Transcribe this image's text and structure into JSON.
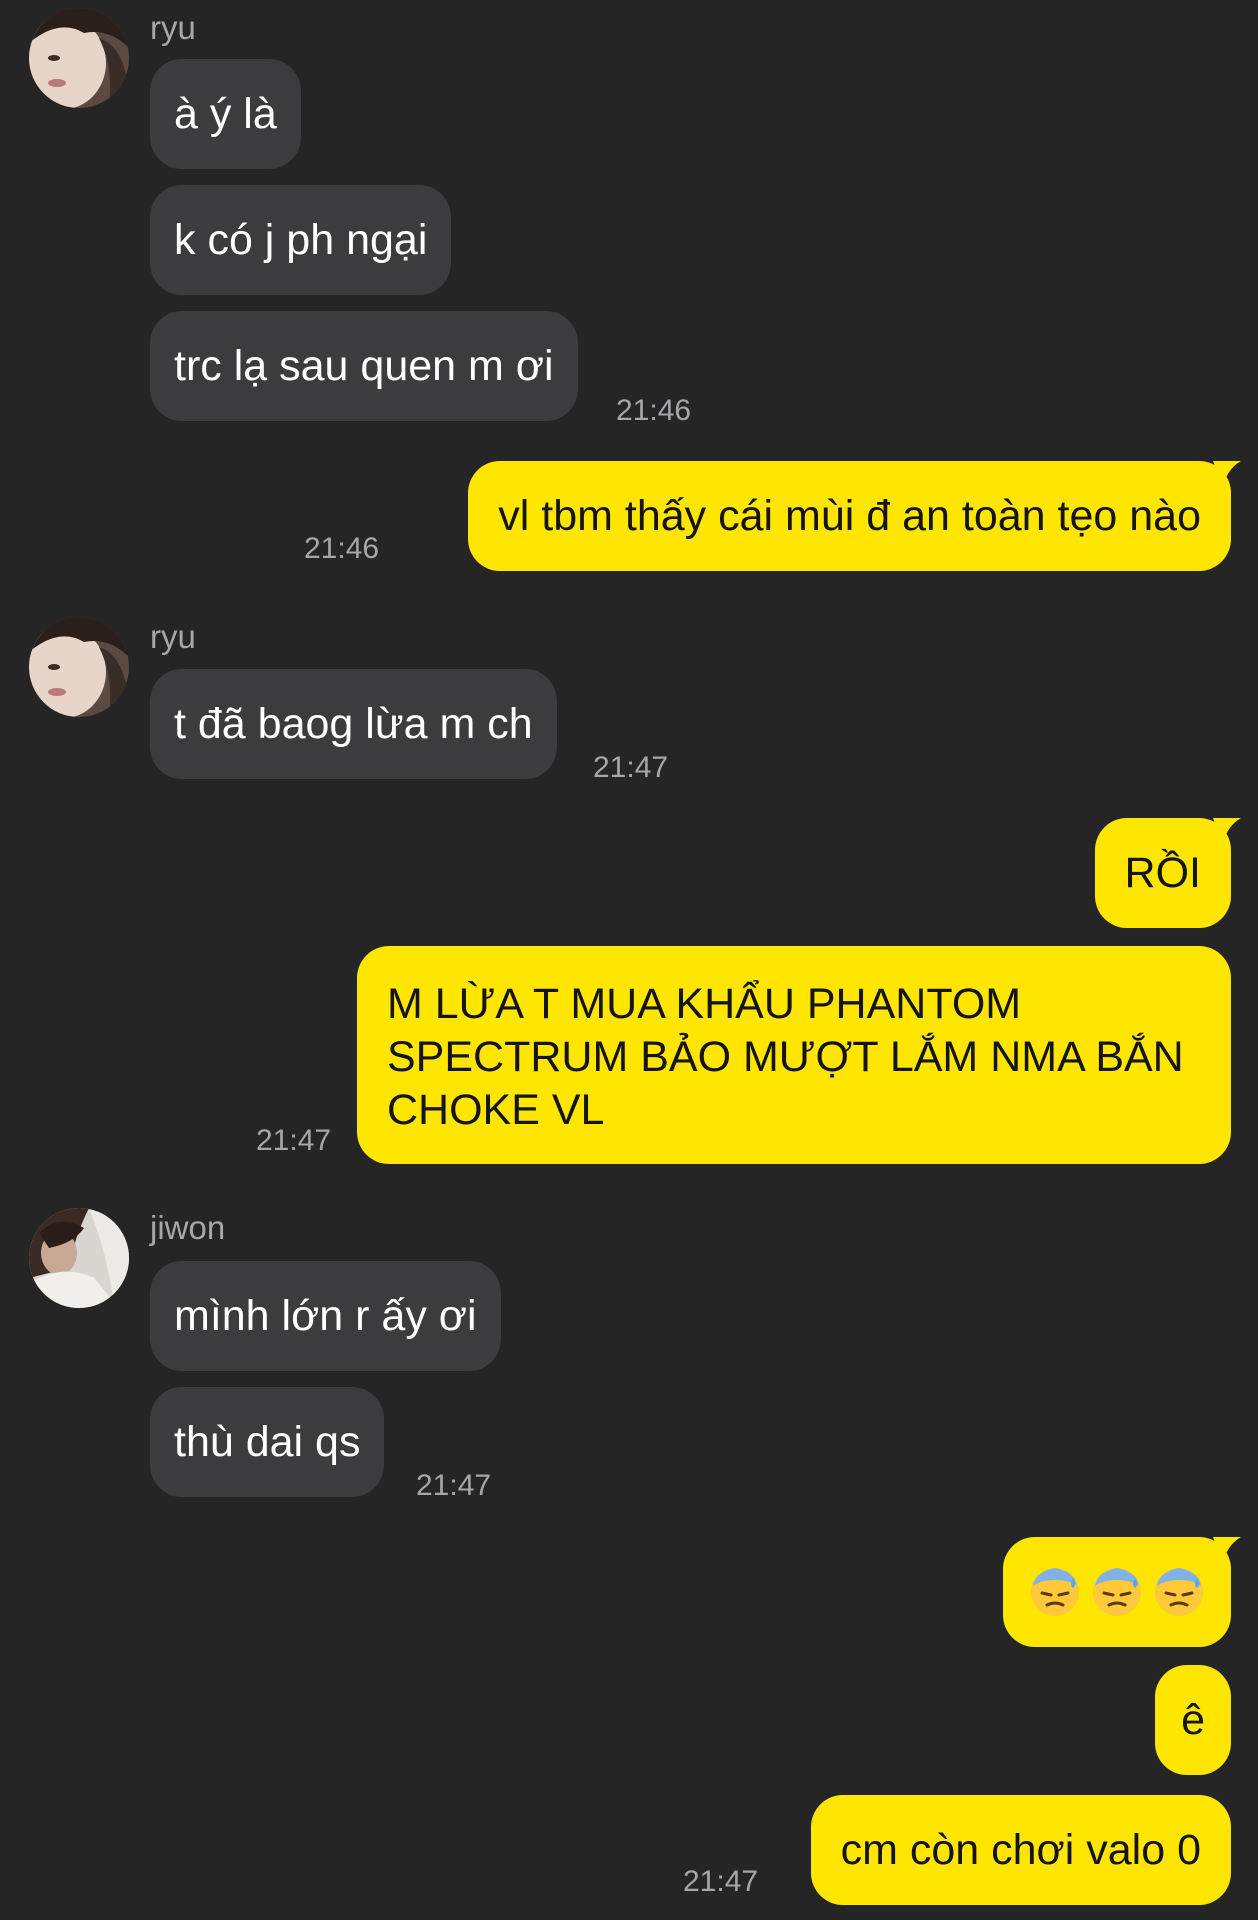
{
  "chat": {
    "messages": [
      {
        "sender": "ryu",
        "text": "à ý là"
      },
      {
        "text": "k có j ph ngại"
      },
      {
        "text": "trc lạ sau quen m ơi",
        "time": "21:46"
      },
      {
        "text": "vl tbm thấy cái mùi đ an toàn tẹo nào",
        "time": "21:46"
      },
      {
        "sender": "ryu",
        "text": "t đã baog lừa m ch",
        "time": "21:47"
      },
      {
        "text": "RỒI"
      },
      {
        "text": "M LỪA T MUA KHẨU PHANTOM SPECTRUM BẢO MƯỢT LẮM NMA BẮN CHOKE VL",
        "time": "21:47"
      },
      {
        "sender": "jiwon",
        "text": "mình lớn r ấy ơi"
      },
      {
        "text": "thù dai qs",
        "time": "21:47"
      },
      {
        "emoji_icons": [
          "downcast-face-with-sweat-icon",
          "downcast-face-with-sweat-icon",
          "downcast-face-with-sweat-icon"
        ]
      },
      {
        "text": "ê"
      },
      {
        "text": "cm còn chơi valo 0",
        "time": "21:47"
      }
    ]
  },
  "colors": {
    "background": "#252526",
    "incoming_bubble": "#3c3c3e",
    "outgoing_bubble": "#ffe600",
    "secondary_text": "#a7a7a9"
  }
}
